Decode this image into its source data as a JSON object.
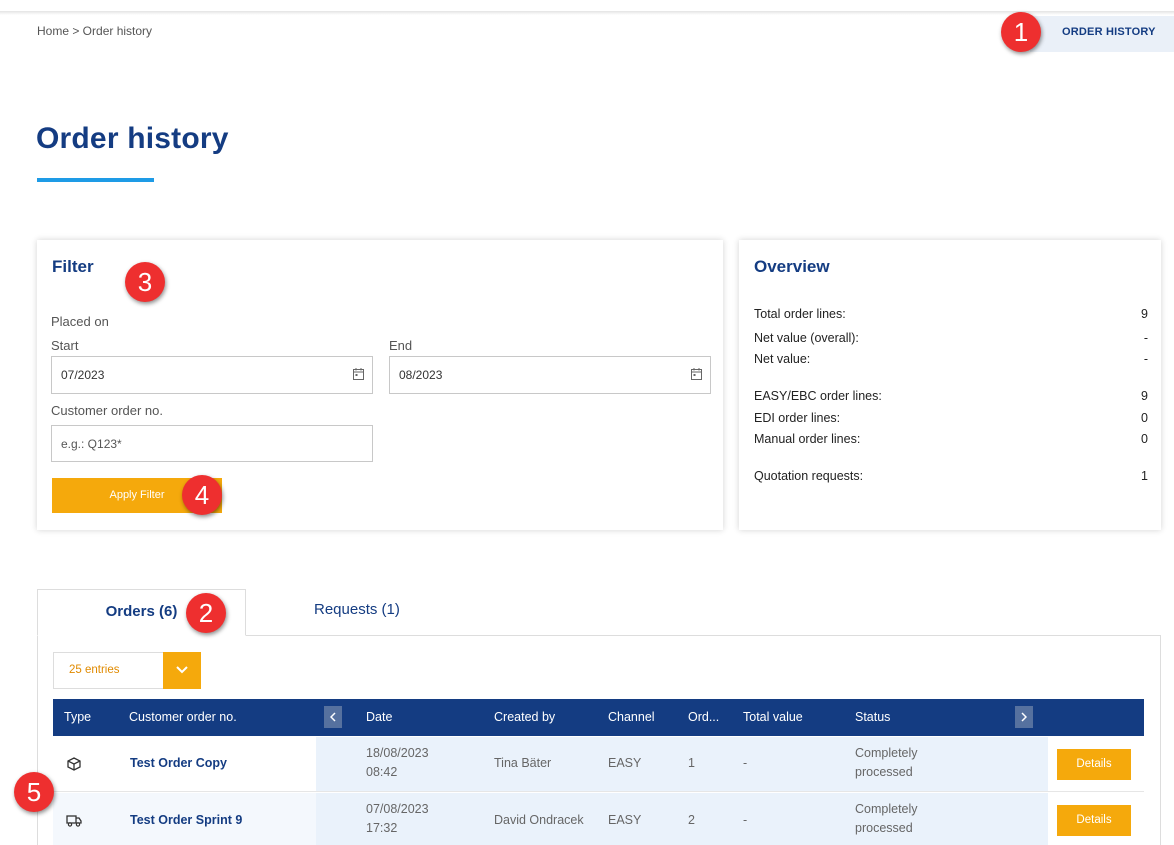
{
  "header": {
    "breadcrumb": "Home > Order history",
    "nav_link": "ORDER HISTORY"
  },
  "page": {
    "title": "Order history"
  },
  "filter": {
    "title": "Filter",
    "placed_on_label": "Placed on",
    "start_label": "Start",
    "start_value": "07/2023",
    "end_label": "End",
    "end_value": "08/2023",
    "customer_order_label": "Customer order no.",
    "customer_order_placeholder": "e.g.: Q123*",
    "apply_button": "Apply Filter"
  },
  "overview": {
    "title": "Overview",
    "rows": [
      {
        "label": "Total order lines:",
        "value": "9"
      },
      {
        "label": "Net value (overall):",
        "value": "-"
      },
      {
        "label": "Net value:",
        "value": "-"
      },
      {
        "label": "EASY/EBC order lines:",
        "value": "9"
      },
      {
        "label": "EDI order lines:",
        "value": "0"
      },
      {
        "label": "Manual order lines:",
        "value": "0"
      },
      {
        "label": "Quotation requests:",
        "value": "1"
      }
    ]
  },
  "tabs": [
    {
      "label": "Orders (6)",
      "active": true
    },
    {
      "label": "Requests (1)",
      "active": false
    }
  ],
  "entries_select": {
    "selected": "25 entries"
  },
  "table": {
    "columns": [
      "Type",
      "Customer order no.",
      "Date",
      "Created by",
      "Channel",
      "Ord...",
      "Total value",
      "Status"
    ],
    "rows": [
      {
        "type_icon": "box-icon",
        "customer_order_no": "Test Order Copy",
        "date": "18/08/2023",
        "time": "08:42",
        "created_by": "Tina Bäter",
        "channel": "EASY",
        "ord": "1",
        "total_value": "-",
        "status_line1": "Completely",
        "status_line2": "processed",
        "action": "Details"
      },
      {
        "type_icon": "truck-icon",
        "customer_order_no": "Test Order Sprint 9",
        "date": "07/08/2023",
        "time": "17:32",
        "created_by": "David Ondracek",
        "channel": "EASY",
        "ord": "2",
        "total_value": "-",
        "status_line1": "Completely",
        "status_line2": "processed",
        "action": "Details"
      }
    ]
  },
  "annotations": [
    "1",
    "2",
    "3",
    "4",
    "5"
  ],
  "colors": {
    "brand_blue": "#143c82",
    "accent_blue": "#1e9be6",
    "accent_orange": "#f5a90c",
    "marker_red": "#ee2f2f"
  }
}
